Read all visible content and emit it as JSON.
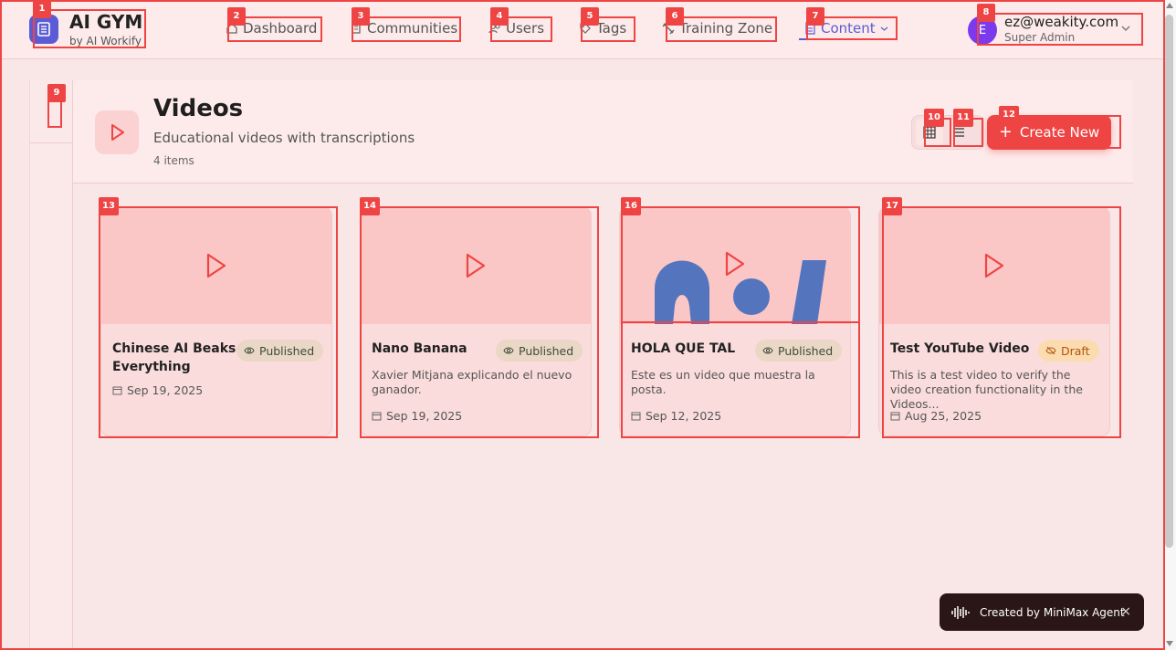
{
  "brand": {
    "title": "AI GYM",
    "subtitle": "by AI Workify"
  },
  "nav": [
    {
      "label": "Dashboard",
      "icon": "home-icon"
    },
    {
      "label": "Communities",
      "icon": "building-icon"
    },
    {
      "label": "Users",
      "icon": "users-icon"
    },
    {
      "label": "Tags",
      "icon": "tag-icon"
    },
    {
      "label": "Training Zone",
      "icon": "dumbbell-icon"
    },
    {
      "label": "Content",
      "icon": "document-icon",
      "active": true
    }
  ],
  "user": {
    "initial": "E",
    "email": "ez@weakity.com",
    "role": "Super Admin"
  },
  "page": {
    "title": "Videos",
    "subtitle": "Educational videos with transcriptions",
    "count": "4 items",
    "create_label": "Create New"
  },
  "videos": [
    {
      "title": "Chinese AI Beaks Everything",
      "status": "Published",
      "description": "",
      "date": "Sep 19, 2025"
    },
    {
      "title": "Nano Banana",
      "status": "Published",
      "description": "Xavier Mitjana explicando el nuevo ganador.",
      "date": "Sep 19, 2025"
    },
    {
      "title": "HOLA QUE TAL",
      "status": "Published",
      "description": "Este es un video que muestra la posta.",
      "date": "Sep 12, 2025"
    },
    {
      "title": "Test YouTube Video",
      "status": "Draft",
      "description": "This is a test video to verify the video creation functionality in the Videos...",
      "date": "Aug 25, 2025"
    }
  ],
  "toast": {
    "text": "Created by MiniMax Agent",
    "close": "×"
  },
  "annotations": [
    "1",
    "2",
    "3",
    "4",
    "5",
    "6",
    "7",
    "8",
    "9",
    "10",
    "11",
    "12",
    "13",
    "14",
    "16",
    "17"
  ],
  "colors": {
    "accent": "#ef4444",
    "primary": "#5b5bd6",
    "background": "#f9e6e6"
  }
}
